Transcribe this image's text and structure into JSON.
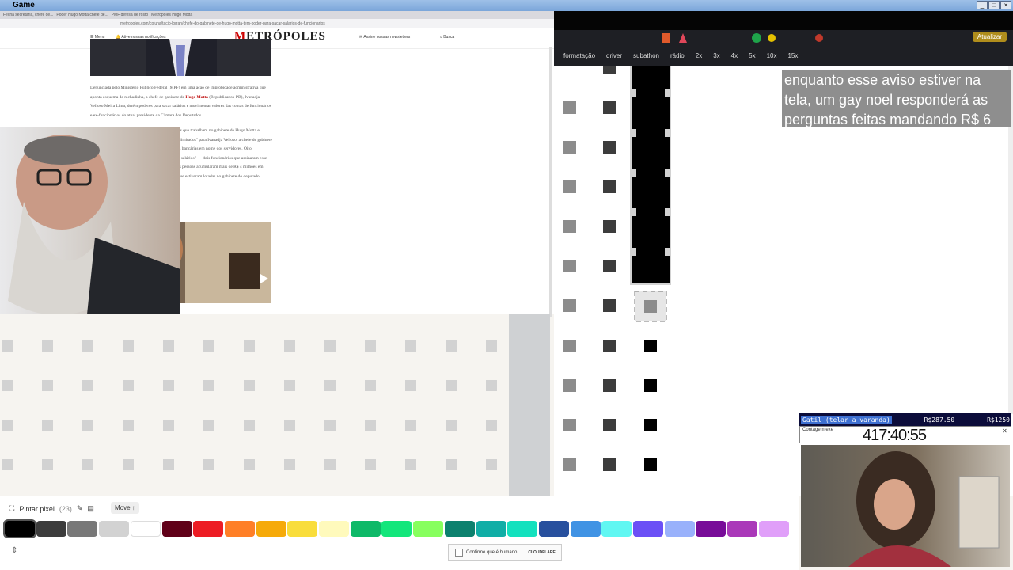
{
  "window": {
    "title": "Game"
  },
  "left_browser": {
    "tabs": [
      "Fecha secretária, chefe de...",
      "Poder Hugo Motta chefe de...",
      "PMF defesa de rosto",
      "Metrópoles Hugo Motta"
    ],
    "url": "metropoles.com/coluna/tacio-lorran/chefe-do-gabinete-de-hugo-motta-tem-poder-para-sacar-salarios-de-funcionarios",
    "nav": {
      "menu": "Menu",
      "notifications": "Ative nossas notificações",
      "logo_initial": "M",
      "logo_rest": "ETRÓPOLES",
      "newsletter": "Assine nossas newsletters",
      "search": "Busca"
    },
    "article": {
      "p1_start": "Denunciada pelo Ministério Público Federal (MPF) em uma ação de improbidade administrativa que aponta esquema de rachadinha, a chefe de gabinete de ",
      "p1_highlight": "Hugo Motta",
      "p1_end": " (Republicanos-PB), Ivanadja Velloso Meira Lima, detém poderes para sacar salários e movimentar valores das contas de funcionários e ex-funcionários do atual presidente da Câmara dos Deputados.",
      "p2": "Investigação feita pela coluna identificou 10 pessoas que trabalham no gabinete de Hugo Motta e assinaram procurações que dão poderes \"amplos e ilimitados\" para Ivanadja Velloso, a chefe de gabinete do deputado, fazer saques e realizar movimentações bancárias em nome dos servidores. Oito procurações lhe permitem, explicitamente, \"receber salários\" — dois funcionários que assinaram esse documento seguem no gabinete dele. No total, essas pessoas acumularam mais de R$ 4 milhões em remunerações, considerando apenas o período em que estiveram lotadas no gabinete do deputado paraibano."
    }
  },
  "right_browser": {
    "bookmarks": [
      "formatação",
      "driver",
      "subathon",
      "rádio",
      "2x",
      "3x",
      "4x",
      "5x",
      "10x",
      "15x"
    ],
    "update_button": "Atualizar"
  },
  "overlay_notice": "enquanto esse aviso estiver na tela, um gay noel responderá as perguntas feitas mandando R$ 6",
  "toolbar": {
    "tool_label": "Pintar pixel",
    "tool_count": "(23)",
    "move_label": "Move ↑"
  },
  "palette": [
    "#000000",
    "#3c3c3c",
    "#787878",
    "#d2d2d2",
    "#ffffff",
    "#600018",
    "#ed1c24",
    "#ff7f27",
    "#f6aa09",
    "#f9dd3b",
    "#fffabc",
    "#0eb968",
    "#13e67b",
    "#87ff5e",
    "#0c816e",
    "#10aea6",
    "#13e1be",
    "#28509e",
    "#4093e4",
    "#60f7f2",
    "#6b50f6",
    "#99b1fb",
    "#780c99",
    "#aa38b9",
    "#e09ff9"
  ],
  "captcha": {
    "label": "Confirme que é humano",
    "brand": "CLOUDFLARE",
    "links": "Privacidade · Termos"
  },
  "donation": {
    "left_label": "Gatil (telar a varanda)",
    "amount": "R$287.50",
    "goal": "R$1250"
  },
  "timer_window": {
    "title": "Contagem.exe",
    "time": "417:40:55"
  },
  "colors": {
    "overlay_bg": "#8e8e8e",
    "donate_bar": "#0b0c3a",
    "accent": "#c00000"
  }
}
